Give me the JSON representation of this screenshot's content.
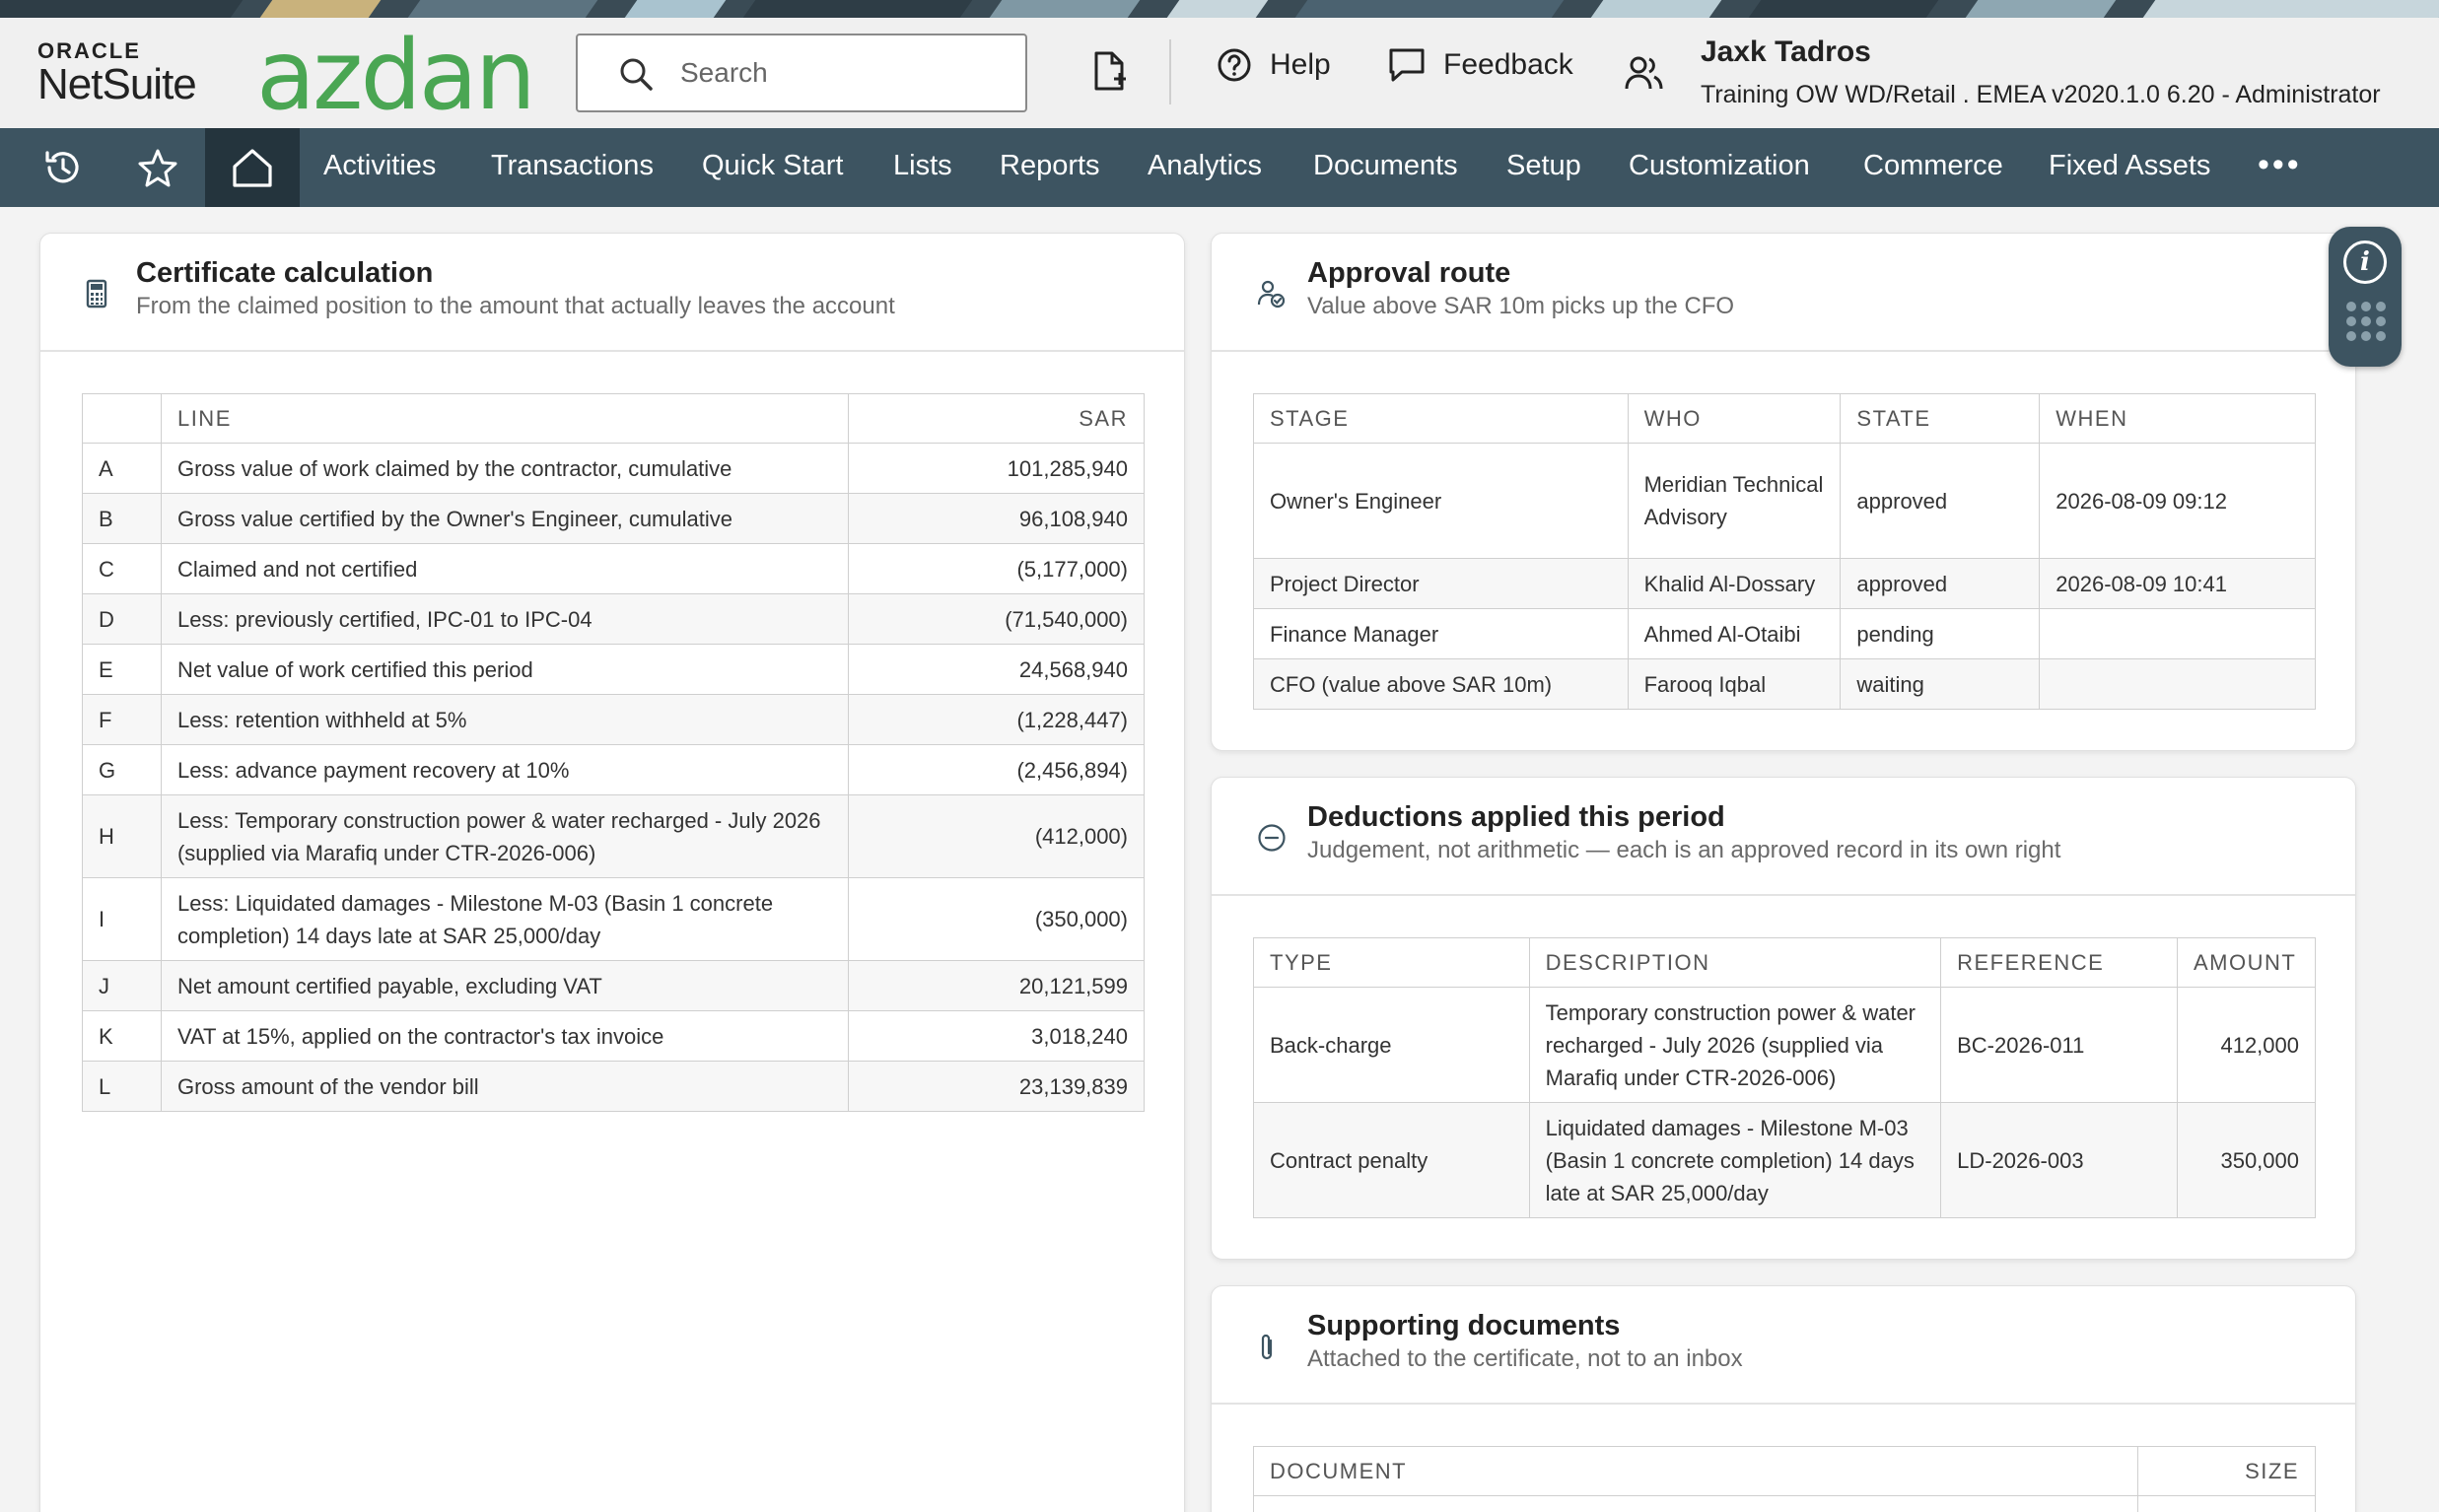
{
  "header": {
    "oracle_label": "ORACLE",
    "netsuite_label": "NetSuite",
    "brand": "azdan",
    "search_placeholder": "Search",
    "help_label": "Help",
    "feedback_label": "Feedback",
    "user_name": "Jaxk Tadros",
    "user_role": "Training OW WD/Retail . EMEA v2020.1.0 6.20 - Administrator"
  },
  "nav": {
    "items": [
      "Activities",
      "Transactions",
      "Quick Start",
      "Lists",
      "Reports",
      "Analytics",
      "Documents",
      "Setup",
      "Customization",
      "Commerce",
      "Fixed Assets"
    ],
    "more": "•••"
  },
  "certificate": {
    "title": "Certificate calculation",
    "subtitle": "From the claimed position to the amount that actually leaves the account",
    "columns": [
      "",
      "LINE",
      "SAR"
    ],
    "rows": [
      {
        "key": "A",
        "line": "Gross value of work claimed by the contractor, cumulative",
        "sar": "101,285,940"
      },
      {
        "key": "B",
        "line": "Gross value certified by the Owner's Engineer, cumulative",
        "sar": "96,108,940"
      },
      {
        "key": "C",
        "line": "Claimed and not certified",
        "sar": "(5,177,000)"
      },
      {
        "key": "D",
        "line": "Less: previously certified, IPC-01 to IPC-04",
        "sar": "(71,540,000)"
      },
      {
        "key": "E",
        "line": "Net value of work certified this period",
        "sar": "24,568,940"
      },
      {
        "key": "F",
        "line": "Less: retention withheld at 5%",
        "sar": "(1,228,447)"
      },
      {
        "key": "G",
        "line": "Less: advance payment recovery at 10%",
        "sar": "(2,456,894)"
      },
      {
        "key": "H",
        "line": "Less: Temporary construction power & water recharged - July 2026 (supplied via Marafiq under CTR-2026-006)",
        "sar": "(412,000)"
      },
      {
        "key": "I",
        "line": "Less: Liquidated damages - Milestone M-03 (Basin 1 concrete completion) 14 days late at SAR 25,000/day",
        "sar": "(350,000)"
      },
      {
        "key": "J",
        "line": "Net amount certified payable, excluding VAT",
        "sar": "20,121,599"
      },
      {
        "key": "K",
        "line": "VAT at 15%, applied on the contractor's tax invoice",
        "sar": "3,018,240"
      },
      {
        "key": "L",
        "line": "Gross amount of the vendor bill",
        "sar": "23,139,839"
      }
    ]
  },
  "approval": {
    "title": "Approval route",
    "subtitle": "Value above SAR 10m picks up the CFO",
    "columns": [
      "STAGE",
      "WHO",
      "STATE",
      "WHEN"
    ],
    "rows": [
      {
        "stage": "Owner's Engineer",
        "who": "Meridian Technical Advisory",
        "state": "approved",
        "when": "2026-08-09 09:12"
      },
      {
        "stage": "Project Director",
        "who": "Khalid Al-Dossary",
        "state": "approved",
        "when": "2026-08-09 10:41"
      },
      {
        "stage": "Finance Manager",
        "who": "Ahmed Al-Otaibi",
        "state": "pending",
        "when": ""
      },
      {
        "stage": "CFO (value above SAR 10m)",
        "who": "Farooq Iqbal",
        "state": "waiting",
        "when": ""
      }
    ]
  },
  "deductions": {
    "title": "Deductions applied this period",
    "subtitle": "Judgement, not arithmetic — each is an approved record in its own right",
    "columns": [
      "TYPE",
      "DESCRIPTION",
      "REFERENCE",
      "AMOUNT"
    ],
    "rows": [
      {
        "type": "Back-charge",
        "description": "Temporary construction power & water recharged - July 2026 (supplied via Marafiq under CTR-2026-006)",
        "reference": "BC-2026-011",
        "amount": "412,000"
      },
      {
        "type": "Contract penalty",
        "description": "Liquidated damages - Milestone M-03 (Basin 1 concrete completion) 14 days late at SAR 25,000/day",
        "reference": "LD-2026-003",
        "amount": "350,000"
      }
    ]
  },
  "documents": {
    "title": "Supporting documents",
    "subtitle": "Attached to the certificate, not to an inbox",
    "columns": [
      "DOCUMENT",
      "SIZE"
    ]
  },
  "colors": {
    "nav_bg": "#3d5461",
    "nav_active": "#24343d",
    "brand_green": "#4aa653"
  },
  "icons": [
    "search-icon",
    "new-record-icon",
    "help-icon",
    "feedback-icon",
    "user-roles-icon",
    "recent-icon",
    "star-icon",
    "home-icon",
    "calculator-icon",
    "approver-icon",
    "minus-circle-icon",
    "paperclip-icon",
    "info-icon",
    "grid-dots-icon"
  ]
}
